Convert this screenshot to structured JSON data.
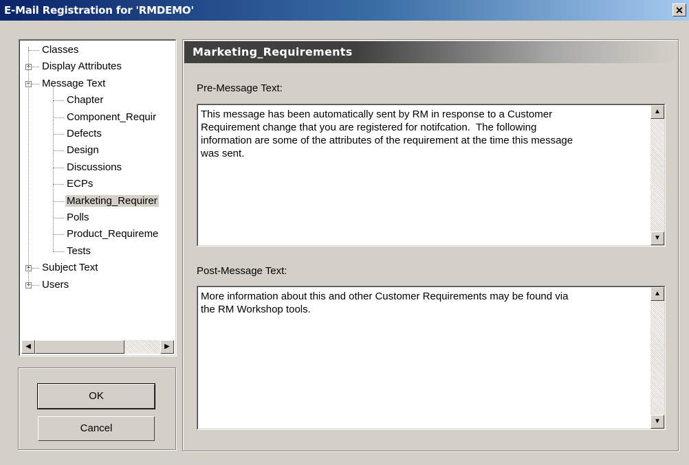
{
  "window": {
    "title": "E-Mail Registration for 'RMDEMO'",
    "close_glyph": "✕"
  },
  "tree": {
    "items": [
      {
        "label": "Classes",
        "level": 0,
        "expander": ""
      },
      {
        "label": "Display Attributes",
        "level": 0,
        "expander": "+"
      },
      {
        "label": "Message Text",
        "level": 0,
        "expander": "−"
      },
      {
        "label": "Chapter",
        "level": 1,
        "expander": ""
      },
      {
        "label": "Component_Requir",
        "level": 1,
        "expander": ""
      },
      {
        "label": "Defects",
        "level": 1,
        "expander": ""
      },
      {
        "label": "Design",
        "level": 1,
        "expander": ""
      },
      {
        "label": "Discussions",
        "level": 1,
        "expander": ""
      },
      {
        "label": "ECPs",
        "level": 1,
        "expander": ""
      },
      {
        "label": "Marketing_Requirer",
        "level": 1,
        "expander": "",
        "selected": true
      },
      {
        "label": "Polls",
        "level": 1,
        "expander": ""
      },
      {
        "label": "Product_Requireme",
        "level": 1,
        "expander": ""
      },
      {
        "label": "Tests",
        "level": 1,
        "expander": ""
      },
      {
        "label": "Subject Text",
        "level": 0,
        "expander": "+"
      },
      {
        "label": "Users",
        "level": 0,
        "expander": "+"
      }
    ],
    "scroll_left_glyph": "◀",
    "scroll_right_glyph": "▶"
  },
  "buttons": {
    "ok_label": "OK",
    "cancel_label": "Cancel"
  },
  "panel": {
    "header_title": "Marketing_Requirements",
    "pre_label": "Pre-Message Text:",
    "pre_text": "This message has been automatically sent by RM in response to a Customer\nRequirement change that you are registered for notifcation.  The following\ninformation are some of the attributes of the requirement at the time this message\nwas sent.",
    "post_label": "Post-Message Text:",
    "post_text": "More information about this and other Customer Requirements may be found via\nthe RM Workshop tools.",
    "scroll_up_glyph": "▲",
    "scroll_down_glyph": "▼"
  }
}
